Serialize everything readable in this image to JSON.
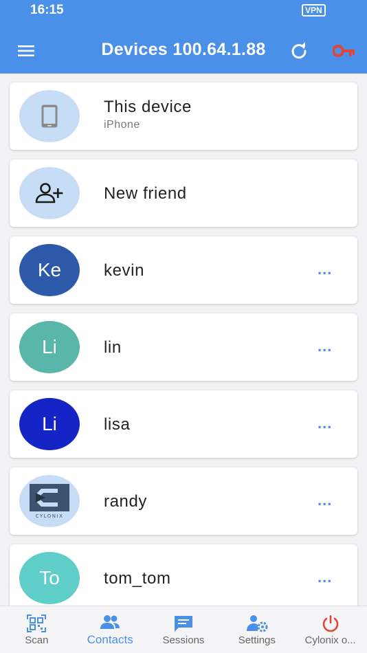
{
  "status_bar": {
    "time": "16:15",
    "vpn": "VPN"
  },
  "header": {
    "title": "Devices 100.64.1.88"
  },
  "colors": {
    "header": "#4a90e8",
    "accent": "#4a90e8",
    "key": "#e0453a",
    "power": "#e0453a"
  },
  "contacts": [
    {
      "initials": "",
      "name": "This device",
      "subtitle": "iPhone",
      "avatar_color": "#c7ddf6",
      "icon": "phone-icon"
    },
    {
      "initials": "",
      "name": "New friend",
      "avatar_color": "#c7ddf6",
      "icon": "add-friend-icon"
    },
    {
      "initials": "Ke",
      "name": "kevin",
      "avatar_color": "#2d5aa8",
      "more": "..."
    },
    {
      "initials": "Li",
      "name": "lin",
      "avatar_color": "#59b6a9",
      "more": "..."
    },
    {
      "initials": "Li",
      "name": "lisa",
      "avatar_color": "#1524c7",
      "more": "..."
    },
    {
      "initials": "",
      "name": "randy",
      "avatar_color": "#c7ddf6",
      "logo_text": "CYLONIX",
      "more": "..."
    },
    {
      "initials": "To",
      "name": "tom_tom",
      "avatar_color": "#5fcdc8",
      "more": "..."
    }
  ],
  "tabs": [
    {
      "label": "Scan",
      "icon": "qr-scan-icon"
    },
    {
      "label": "Contacts",
      "icon": "contacts-icon",
      "active": true
    },
    {
      "label": "Sessions",
      "icon": "chat-icon"
    },
    {
      "label": "Settings",
      "icon": "settings-icon"
    },
    {
      "label": "Cylonix o...",
      "icon": "power-icon"
    }
  ]
}
